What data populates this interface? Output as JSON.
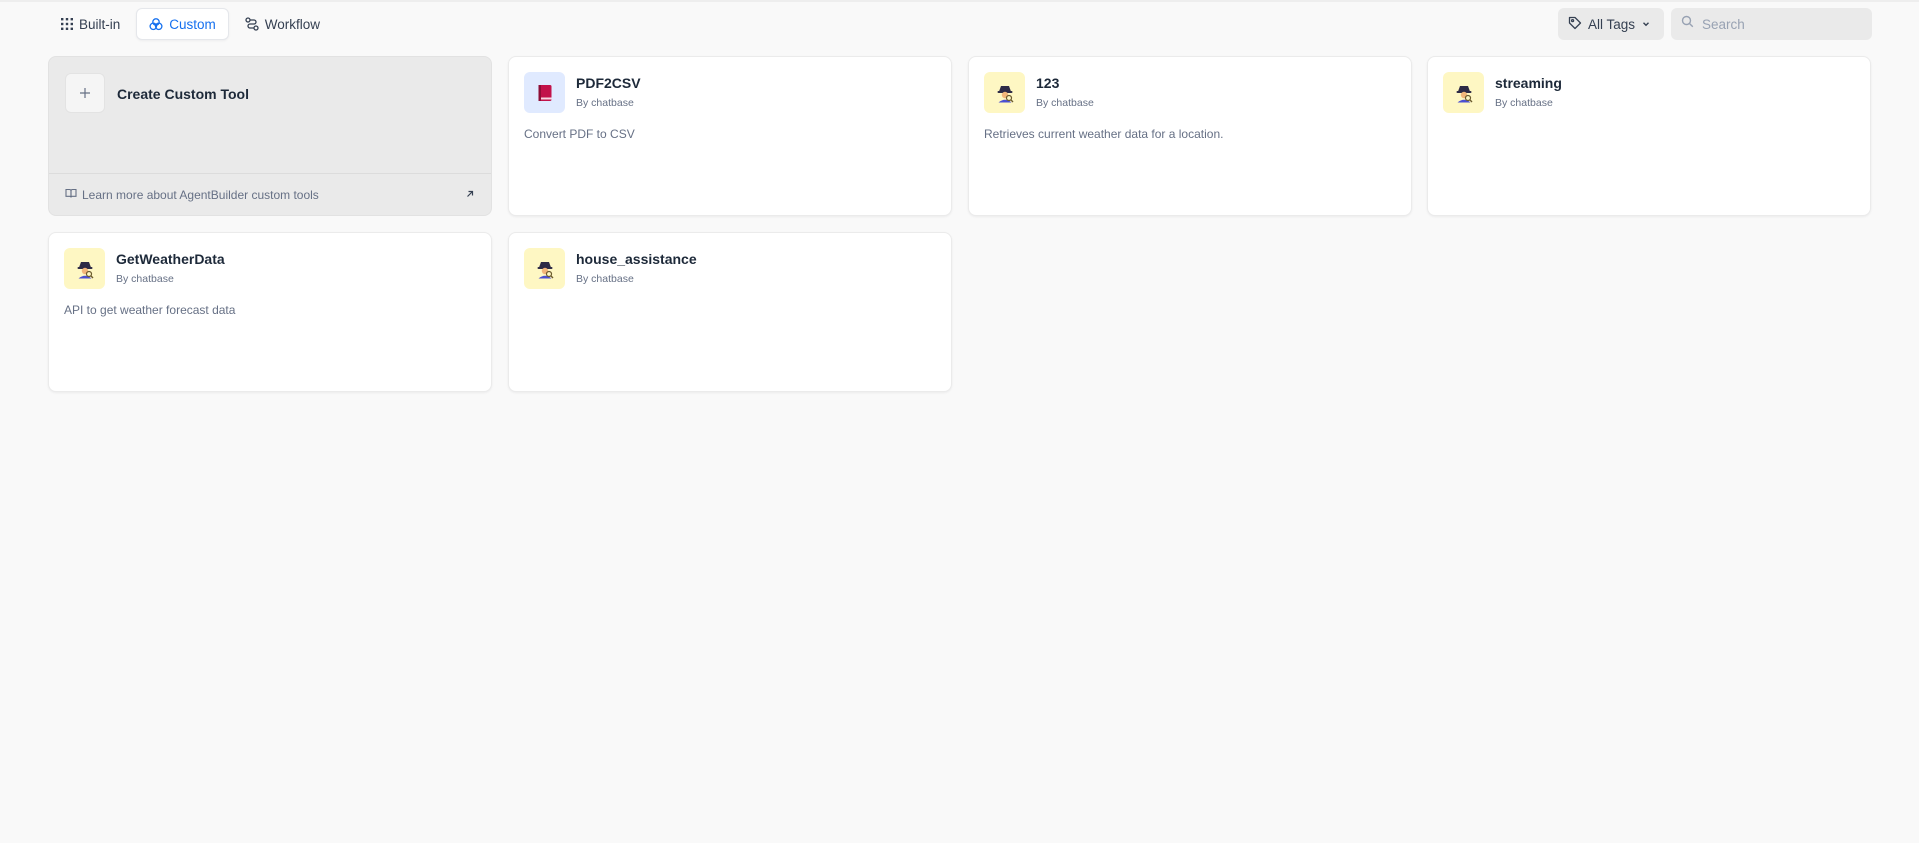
{
  "tabs": [
    {
      "label": "Built-in",
      "icon": "grid-icon",
      "active": false
    },
    {
      "label": "Custom",
      "icon": "custom-icon",
      "active": true
    },
    {
      "label": "Workflow",
      "icon": "workflow-icon",
      "active": false
    }
  ],
  "tag_filter": {
    "label": "All Tags",
    "icon": "tag-icon"
  },
  "search": {
    "placeholder": "Search",
    "value": ""
  },
  "create_card": {
    "label": "Create Custom Tool",
    "learn_more": "Learn more about AgentBuilder custom tools"
  },
  "tools": [
    {
      "name": "PDF2CSV",
      "author": "By chatbase",
      "description": "Convert PDF to CSV",
      "icon": "book-icon",
      "icon_bg": "#e0eaff"
    },
    {
      "name": "123",
      "author": "By chatbase",
      "description": "Retrieves current weather data for a location.",
      "icon": "detective-icon",
      "icon_bg": "#fef7c3"
    },
    {
      "name": "streaming",
      "author": "By chatbase",
      "description": "",
      "icon": "detective-icon",
      "icon_bg": "#fef7c3"
    },
    {
      "name": "GetWeatherData",
      "author": "By chatbase",
      "description": "API to get weather forecast data",
      "icon": "detective-icon",
      "icon_bg": "#fef7c3"
    },
    {
      "name": "house_assistance",
      "author": "By chatbase",
      "description": "",
      "icon": "detective-icon",
      "icon_bg": "#fef7c3"
    }
  ],
  "colors": {
    "accent": "#1570ef",
    "card_bg": "#ffffff",
    "page_bg": "#f9f9f9"
  }
}
